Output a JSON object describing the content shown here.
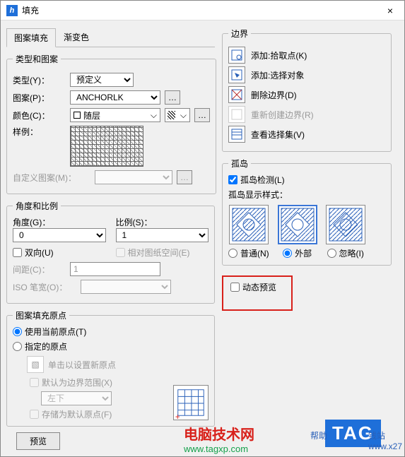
{
  "window": {
    "title": "填充",
    "close": "×",
    "app_icon_letter": "h"
  },
  "tabs": {
    "pattern_fill": "图案填充",
    "gradient": "渐变色"
  },
  "type_pattern": {
    "legend": "类型和图案",
    "type_label": "类型(Y)：",
    "type_value": "预定义",
    "pattern_label": "图案(P)：",
    "pattern_value": "ANCHORLK",
    "color_label": "颜色(C)：",
    "color_value": "随层",
    "sample_label": "样例：",
    "custom_pattern_label": "自定义图案(M)："
  },
  "angle_scale": {
    "legend": "角度和比例",
    "angle_label": "角度(G)：",
    "angle_value": "0",
    "scale_label": "比例(S)：",
    "scale_value": "1",
    "bidir": "双向(U)",
    "relative_paper": "相对图纸空间(E)",
    "spacing_label": "间距(C)：",
    "spacing_value": "1",
    "iso_pen_label": "ISO 笔宽(O)："
  },
  "origin": {
    "legend": "图案填充原点",
    "use_current": "使用当前原点(T)",
    "specified": "指定的原点",
    "click_new": "单击以设置新原点",
    "default_bounds": "默认为边界范围(X)",
    "position_value": "左下",
    "store_default": "存储为默认原点(F)"
  },
  "preview_btn": "预览",
  "boundary": {
    "legend": "边界",
    "pick_point": "添加:拾取点(K)",
    "select_obj": "添加:选择对象",
    "remove": "删除边界(D)",
    "recreate": "重新创建边界(R)",
    "view_sel": "查看选择集(V)"
  },
  "island": {
    "legend": "孤岛",
    "detect": "孤岛检测(L)",
    "display_style": "孤岛显示样式：",
    "normal": "普通(N)",
    "outer": "外部",
    "ignore": "忽略(I)"
  },
  "dynamic_preview": "动态预览",
  "footer": {
    "tech": "电脑技术网",
    "url": "www.tagxp.com",
    "tag": "TAG",
    "help": "帮助",
    "site2": "钱站",
    "url2": "www.x27"
  }
}
